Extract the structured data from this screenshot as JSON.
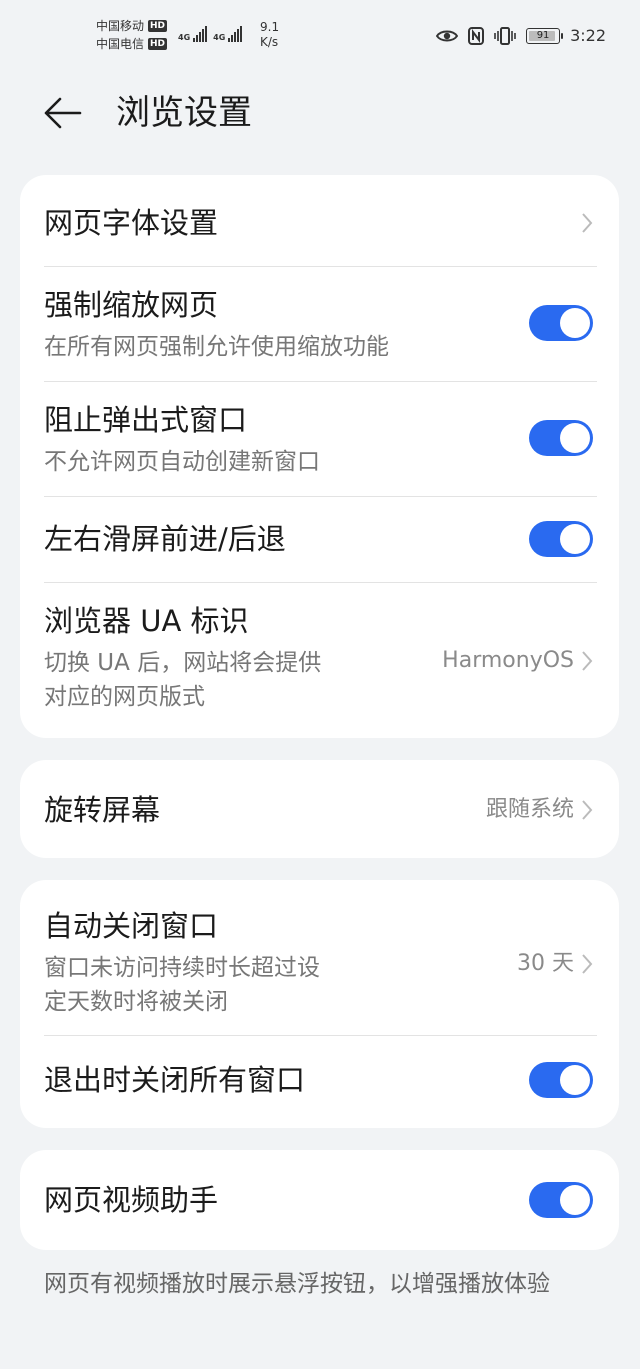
{
  "status_bar": {
    "carrier1": "中国移动",
    "carrier2": "中国电信",
    "hd_badge": "HD",
    "network1": "4G",
    "network2": "4G",
    "speed_value": "9.1",
    "speed_unit": "K/s",
    "battery": "91",
    "battery_level": 0.91,
    "time": "3:22",
    "icons": [
      "eye-icon",
      "nfc-icon",
      "vibrate-icon",
      "battery-icon"
    ]
  },
  "header": {
    "title": "浏览设置"
  },
  "group1": {
    "font_settings": {
      "title": "网页字体设置"
    },
    "force_zoom": {
      "title": "强制缩放网页",
      "subtitle": "在所有网页强制允许使用缩放功能",
      "enabled": true
    },
    "block_popups": {
      "title": "阻止弹出式窗口",
      "subtitle": "不允许网页自动创建新窗口",
      "enabled": true
    },
    "swipe_nav": {
      "title": "左右滑屏前进/后退",
      "enabled": true
    },
    "ua": {
      "title": "浏览器 UA 标识",
      "subtitle_line1": "切换 UA 后，网站将会提供",
      "subtitle_line2": "对应的网页版式",
      "value": "HarmonyOS"
    }
  },
  "group2": {
    "rotate": {
      "title": "旋转屏幕",
      "value": "跟随系统"
    }
  },
  "group3": {
    "auto_close": {
      "title": "自动关闭窗口",
      "subtitle_line1": "窗口未访问持续时长超过设",
      "subtitle_line2": "定天数时将被关闭",
      "value": "30 天"
    },
    "close_on_exit": {
      "title": "退出时关闭所有窗口",
      "enabled": true
    }
  },
  "group4": {
    "video_helper": {
      "title": "网页视频助手",
      "enabled": true
    }
  },
  "footnote": "网页有视频播放时展示悬浮按钮，以增强播放体验",
  "colors": {
    "toggle_on": "#2a6af0",
    "background": "#f1f3f5",
    "card": "#ffffff"
  }
}
